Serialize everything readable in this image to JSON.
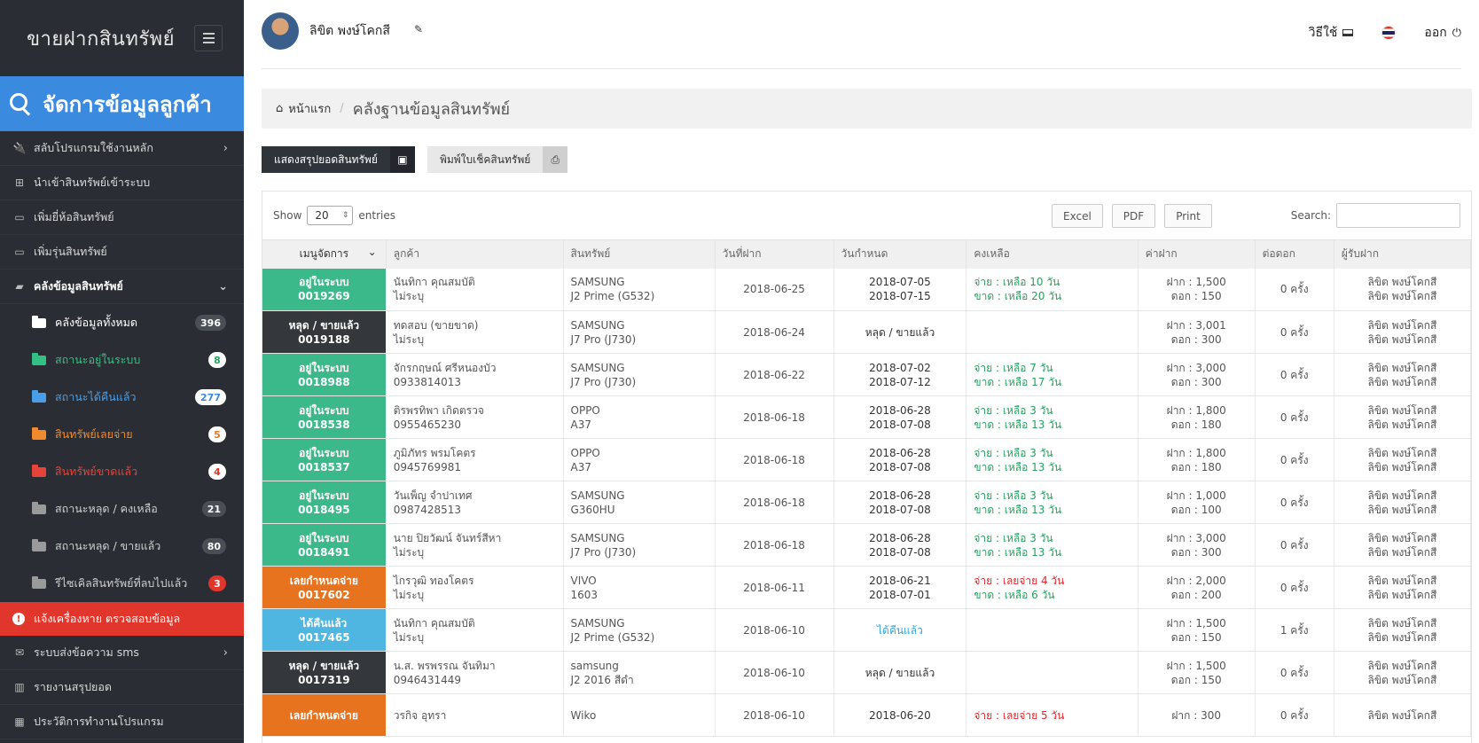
{
  "sidebar": {
    "brand": "ขายฝากสินทรัพย์",
    "banner": "จัดการข้อมูลลูกค้า",
    "menu_top": [
      {
        "label": "สลับโปรแกรมใช้งานหลัก",
        "icon": "plug-icon",
        "glyph": "🔌",
        "chevron": "›"
      },
      {
        "label": "นำเข้าสินทรัพย์เข้าระบบ",
        "icon": "plus-square-icon",
        "glyph": "⊞",
        "chevron": ""
      },
      {
        "label": "เพิ่มยี่ห้อสินทรัพย์",
        "icon": "laptop-icon",
        "glyph": "▭",
        "chevron": ""
      },
      {
        "label": "เพิ่มรุ่นสินทรัพย์",
        "icon": "laptop-icon",
        "glyph": "▭",
        "chevron": ""
      },
      {
        "label": "คลังข้อมูลสินทรัพย์",
        "icon": "folder-open-icon",
        "glyph": "▰",
        "chevron": "⌄"
      }
    ],
    "sub_items": [
      {
        "label": "คลังข้อมูลทั้งหมด",
        "count": "396",
        "color": "#ffffff",
        "folder": "#ffffff",
        "badge_bg": "#4a4e55",
        "badge_fg": "#ffffff"
      },
      {
        "label": "สถานะอยู่ในระบบ",
        "count": "8",
        "color": "#33c183",
        "folder": "#33c183",
        "badge_bg": "#ffffff",
        "badge_fg": "#27a15f"
      },
      {
        "label": "สถานะได้คืนแล้ว",
        "count": "277",
        "color": "#4a9ee8",
        "folder": "#4a9ee8",
        "badge_bg": "#ffffff",
        "badge_fg": "#3a8be0"
      },
      {
        "label": "สินทรัพย์เลยจ่าย",
        "count": "5",
        "color": "#f08a2c",
        "folder": "#f08a2c",
        "badge_bg": "#ffffff",
        "badge_fg": "#e07a1f"
      },
      {
        "label": "สินทรัพย์ขาดแล้ว",
        "count": "4",
        "color": "#e7433a",
        "folder": "#e7433a",
        "badge_bg": "#ffffff",
        "badge_fg": "#e0362c"
      },
      {
        "label": "สถานะหลุด / คงเหลือ",
        "count": "21",
        "color": "#cfcfcf",
        "folder": "#9a9a9a",
        "badge_bg": "#4a4e55",
        "badge_fg": "#ffffff"
      },
      {
        "label": "สถานะหลุด / ขายแล้ว",
        "count": "80",
        "color": "#cfcfcf",
        "folder": "#9a9a9a",
        "badge_bg": "#4a4e55",
        "badge_fg": "#ffffff"
      },
      {
        "label": "รีไซเคิลสินทรัพย์ที่ลบไปแล้ว",
        "count": "3",
        "color": "#cfcfcf",
        "folder": "#9a9a9a",
        "badge_bg": "#e0362c",
        "badge_fg": "#ffffff"
      }
    ],
    "alert": "แจ้งเครื่องหาย ตรวจสอบข้อมูล",
    "menu_bottom": [
      {
        "label": "ระบบส่งข้อความ sms",
        "icon": "envelope-icon",
        "glyph": "✉",
        "chevron": "›"
      },
      {
        "label": "รายงานสรุปยอด",
        "icon": "bar-chart-icon",
        "glyph": "▥",
        "chevron": ""
      },
      {
        "label": "ประวัติการทำงานโปรแกรม",
        "icon": "calendar-icon",
        "glyph": "▦",
        "chevron": ""
      }
    ]
  },
  "header": {
    "username": "ลิขิต พงษ์โคกสี",
    "help_label": "วิธีใช้",
    "logout_label": "ออก"
  },
  "breadcrumb": {
    "home": "หน้าแรก",
    "current": "คลังฐานข้อมูลสินทรัพย์"
  },
  "actions": {
    "summary_label": "แสดงสรุปยอดสินทรัพย์",
    "print_label": "พิมพ์ใบเช็คสินทรัพย์"
  },
  "datatable": {
    "show_label": "Show",
    "entries_value": "20",
    "entries_label": "entries",
    "buttons": [
      "Excel",
      "PDF",
      "Print"
    ],
    "search_label": "Search:",
    "headers": [
      "เมนูจัดการ",
      "ลูกค้า",
      "สินทรัพย์",
      "วันที่ฝาก",
      "วันกำหนด",
      "คงเหลือ",
      "ค่าฝาก",
      "ต่อดอก",
      "ผู้รับฝาก"
    ],
    "rows": [
      {
        "status": "อยู่ในระบบ",
        "code": "0019269",
        "status_color": "#3cb98a",
        "customer": "นันทิกา คุณสมบัติ",
        "phone": "ไม่ระบุ",
        "brand": "SAMSUNG",
        "model": "J2 Prime (G532)",
        "deposit_date": "2018-06-25",
        "due1": "2018-07-05",
        "due2": "2018-07-15",
        "due_cls": "dark-txt",
        "rem1": "จ่าย : เหลือ 10 วัน",
        "rem1_cls": "green",
        "rem2": "ขาด : เหลือ 20 วัน",
        "rem2_cls": "green",
        "fee1": "ฝาก : 1,500",
        "fee2": "ดอก : 150",
        "renew": "0 ครั้ง",
        "recv1": "ลิขิต พงษ์โคกสี",
        "recv2": "ลิขิต พงษ์โคกสี"
      },
      {
        "status": "หลุด / ขายแล้ว",
        "code": "0019188",
        "status_color": "#34373c",
        "customer": "ทดสอบ (ขายขาด)",
        "phone": "ไม่ระบุ",
        "brand": "SAMSUNG",
        "model": "J7 Pro (J730)",
        "deposit_date": "2018-06-24",
        "due1": "หลุด / ขายแล้ว",
        "due2": "",
        "due_cls": "dark-txt",
        "rem1": "",
        "rem1_cls": "green",
        "rem2": "",
        "rem2_cls": "green",
        "fee1": "ฝาก : 3,001",
        "fee2": "ดอก : 300",
        "renew": "0 ครั้ง",
        "recv1": "ลิขิต พงษ์โคกสี",
        "recv2": "ลิขิต พงษ์โคกสี"
      },
      {
        "status": "อยู่ในระบบ",
        "code": "0018988",
        "status_color": "#3cb98a",
        "customer": "จักรกฤษณ์ ศรีหนองบัว",
        "phone": "0933814013",
        "brand": "SAMSUNG",
        "model": "J7 Pro (J730)",
        "deposit_date": "2018-06-22",
        "due1": "2018-07-02",
        "due2": "2018-07-12",
        "due_cls": "dark-txt",
        "rem1": "จ่าย : เหลือ 7 วัน",
        "rem1_cls": "green",
        "rem2": "ขาด : เหลือ 17 วัน",
        "rem2_cls": "green",
        "fee1": "ฝาก : 3,000",
        "fee2": "ดอก : 300",
        "renew": "0 ครั้ง",
        "recv1": "ลิขิต พงษ์โคกสี",
        "recv2": "ลิขิต พงษ์โคกสี"
      },
      {
        "status": "อยู่ในระบบ",
        "code": "0018538",
        "status_color": "#3cb98a",
        "customer": "ติรพรทิพา เกิดตรวจ",
        "phone": "0955465230",
        "brand": "OPPO",
        "model": "A37",
        "deposit_date": "2018-06-18",
        "due1": "2018-06-28",
        "due2": "2018-07-08",
        "due_cls": "dark-txt",
        "rem1": "จ่าย : เหลือ 3 วัน",
        "rem1_cls": "green",
        "rem2": "ขาด : เหลือ 13 วัน",
        "rem2_cls": "green",
        "fee1": "ฝาก : 1,800",
        "fee2": "ดอก : 180",
        "renew": "0 ครั้ง",
        "recv1": "ลิขิต พงษ์โคกสี",
        "recv2": "ลิขิต พงษ์โคกสี"
      },
      {
        "status": "อยู่ในระบบ",
        "code": "0018537",
        "status_color": "#3cb98a",
        "customer": "ภูมิภัทร พรมโคตร",
        "phone": "0945769981",
        "brand": "OPPO",
        "model": "A37",
        "deposit_date": "2018-06-18",
        "due1": "2018-06-28",
        "due2": "2018-07-08",
        "due_cls": "dark-txt",
        "rem1": "จ่าย : เหลือ 3 วัน",
        "rem1_cls": "green",
        "rem2": "ขาด : เหลือ 13 วัน",
        "rem2_cls": "green",
        "fee1": "ฝาก : 1,800",
        "fee2": "ดอก : 180",
        "renew": "0 ครั้ง",
        "recv1": "ลิขิต พงษ์โคกสี",
        "recv2": "ลิขิต พงษ์โคกสี"
      },
      {
        "status": "อยู่ในระบบ",
        "code": "0018495",
        "status_color": "#3cb98a",
        "customer": "วันเพ็ญ จำปาเทศ",
        "phone": "0987428513",
        "brand": "SAMSUNG",
        "model": "G360HU",
        "deposit_date": "2018-06-18",
        "due1": "2018-06-28",
        "due2": "2018-07-08",
        "due_cls": "dark-txt",
        "rem1": "จ่าย : เหลือ 3 วัน",
        "rem1_cls": "green",
        "rem2": "ขาด : เหลือ 13 วัน",
        "rem2_cls": "green",
        "fee1": "ฝาก : 1,000",
        "fee2": "ดอก : 100",
        "renew": "0 ครั้ง",
        "recv1": "ลิขิต พงษ์โคกสี",
        "recv2": "ลิขิต พงษ์โคกสี"
      },
      {
        "status": "อยู่ในระบบ",
        "code": "0018491",
        "status_color": "#3cb98a",
        "customer": "นาย ปิยวัฒน์ จันทร์สีหา",
        "phone": "ไม่ระบุ",
        "brand": "SAMSUNG",
        "model": "J7 Pro (J730)",
        "deposit_date": "2018-06-18",
        "due1": "2018-06-28",
        "due2": "2018-07-08",
        "due_cls": "dark-txt",
        "rem1": "จ่าย : เหลือ 3 วัน",
        "rem1_cls": "green",
        "rem2": "ขาด : เหลือ 13 วัน",
        "rem2_cls": "green",
        "fee1": "ฝาก : 3,000",
        "fee2": "ดอก : 300",
        "renew": "0 ครั้ง",
        "recv1": "ลิขิต พงษ์โคกสี",
        "recv2": "ลิขิต พงษ์โคกสี"
      },
      {
        "status": "เลยกำหนดจ่าย",
        "code": "0017602",
        "status_color": "#e8731f",
        "customer": "ไกรวุฒิ ทองโคตร",
        "phone": "ไม่ระบุ",
        "brand": "VIVO",
        "model": "1603",
        "deposit_date": "2018-06-11",
        "due1": "2018-06-21",
        "due2": "2018-07-01",
        "due_cls": "dark-txt",
        "rem1": "จ่าย : เลยจ่าย 4 วัน",
        "rem1_cls": "red",
        "rem2": "ขาด : เหลือ 6 วัน",
        "rem2_cls": "green",
        "fee1": "ฝาก : 2,000",
        "fee2": "ดอก : 200",
        "renew": "0 ครั้ง",
        "recv1": "ลิขิต พงษ์โคกสี",
        "recv2": "ลิขิต พงษ์โคกสี"
      },
      {
        "status": "ได้คืนแล้ว",
        "code": "0017465",
        "status_color": "#4fb6e2",
        "customer": "นันทิกา คุณสมบัติ",
        "phone": "ไม่ระบุ",
        "brand": "SAMSUNG",
        "model": "J2 Prime (G532)",
        "deposit_date": "2018-06-10",
        "due1": "ได้คืนแล้ว",
        "due2": "",
        "due_cls": "blue",
        "rem1": "",
        "rem1_cls": "green",
        "rem2": "",
        "rem2_cls": "green",
        "fee1": "ฝาก : 1,500",
        "fee2": "ดอก : 150",
        "renew": "1 ครั้ง",
        "recv1": "ลิขิต พงษ์โคกสี",
        "recv2": "ลิขิต พงษ์โคกสี"
      },
      {
        "status": "หลุด / ขายแล้ว",
        "code": "0017319",
        "status_color": "#34373c",
        "customer": "น.ส. พรพรรณ จันทิมา",
        "phone": "0946431449",
        "brand": "samsung",
        "model": "J2 2016 สีดำ",
        "deposit_date": "2018-06-10",
        "due1": "หลุด / ขายแล้ว",
        "due2": "",
        "due_cls": "dark-txt",
        "rem1": "",
        "rem1_cls": "green",
        "rem2": "",
        "rem2_cls": "green",
        "fee1": "ฝาก : 1,500",
        "fee2": "ดอก : 150",
        "renew": "0 ครั้ง",
        "recv1": "ลิขิต พงษ์โคกสี",
        "recv2": "ลิขิต พงษ์โคกสี"
      },
      {
        "status": "เลยกำหนดจ่าย",
        "code": "",
        "status_color": "#e8731f",
        "customer": "วรกิจ อุทรา",
        "phone": "",
        "brand": "Wiko",
        "model": "",
        "deposit_date": "2018-06-10",
        "due1": "2018-06-20",
        "due2": "",
        "due_cls": "dark-txt",
        "rem1": "จ่าย : เลยจ่าย 5 วัน",
        "rem1_cls": "red",
        "rem2": "",
        "rem2_cls": "green",
        "fee1": "ฝาก : 300",
        "fee2": "",
        "renew": "0 ครั้ง",
        "recv1": "ลิขิต พงษ์โคกสี",
        "recv2": ""
      }
    ]
  }
}
